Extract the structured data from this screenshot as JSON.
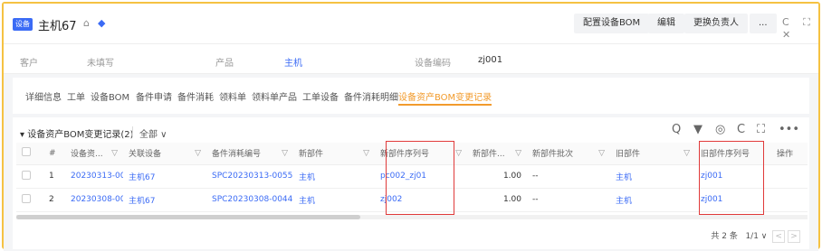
{
  "header": {
    "tag": "设备",
    "title": "主机67",
    "lock_icon": "⌂",
    "pin_icon": "◆",
    "buttons": [
      "配置设备BOM",
      "编辑",
      "更换负责人",
      "..."
    ],
    "win_icons": "C ⛶ ✕"
  },
  "info": {
    "customer_label": "客户",
    "customer_value": "未填写",
    "product_label": "产品",
    "product_value": "主机",
    "code_label": "设备编码",
    "code_value": "zj001"
  },
  "tabs": [
    "详细信息",
    "工单",
    "设备BOM",
    "备件申请",
    "备件消耗",
    "领料单",
    "领料单产品",
    "工单设备",
    "备件消耗明细",
    "设备资产BOM变更记录"
  ],
  "card": {
    "title": "设备资产BOM变更记录(2)",
    "filter": "全部",
    "toolbar": [
      "Q",
      "▼",
      "◎",
      "C",
      "⛶",
      "•••"
    ]
  },
  "table": {
    "headers": [
      "#",
      "设备资...",
      "关联设备",
      "备件消耗编号",
      "新部件",
      "新部件序列号",
      "新部件...",
      "新部件批次",
      "旧部件",
      "旧部件序列号",
      "操作"
    ],
    "rows": [
      [
        "1",
        "20230313-00...",
        "主机67",
        "SPC20230313-0055",
        "主机",
        "pc002_zj01",
        "1.00",
        "--",
        "主机",
        "zj001",
        ""
      ],
      [
        "2",
        "20230308-00...",
        "主机67",
        "SPC20230308-0044",
        "主机",
        "zj002",
        "1.00",
        "--",
        "主机",
        "zj001",
        ""
      ]
    ]
  },
  "pager": {
    "total": "共 2 条",
    "page": "1/1 ∨",
    "prev": "<",
    "next": ">"
  }
}
